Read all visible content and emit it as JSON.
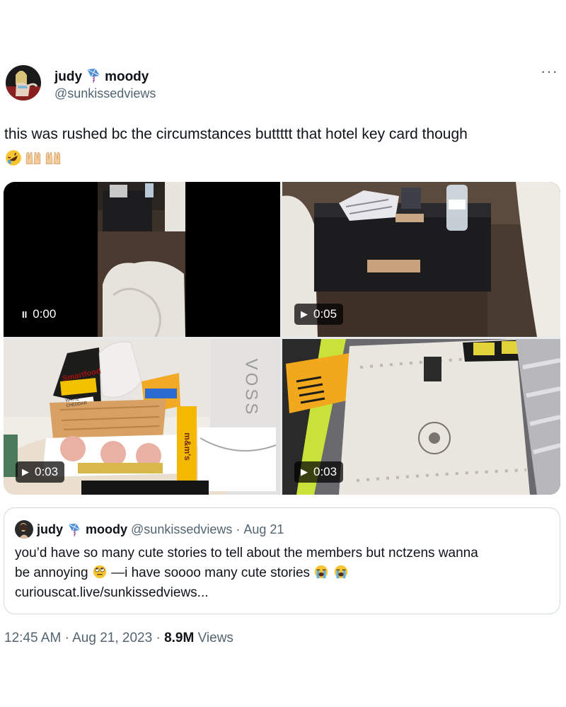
{
  "tweet": {
    "author_name_first": "judy",
    "author_name_second": "moody",
    "author_handle": "@sunkissedviews",
    "more_label": "···",
    "text": "this was rushed bc the circumstances buttttt that hotel key card though",
    "emojis": [
      "rolling-on-floor-laughing",
      "palms-up-together",
      "palms-up-together"
    ]
  },
  "media": [
    {
      "state_icon": "pause-icon",
      "glyph": "II",
      "duration": "0:00"
    },
    {
      "state_icon": "play-icon",
      "glyph": "▶",
      "duration": "0:05"
    },
    {
      "state_icon": "play-icon",
      "glyph": "▶",
      "duration": "0:03"
    },
    {
      "state_icon": "play-icon",
      "glyph": "▶",
      "duration": "0:03"
    }
  ],
  "media_text": {
    "smartfood": "Smartfood",
    "white_cheddar": "WHITE CHEDDAR",
    "voss": "VOSS",
    "mms": "m&m's"
  },
  "quote": {
    "name_first": "judy",
    "name_second": "moody",
    "handle": "@sunkissedviews",
    "separator": "·",
    "date": "Aug 21",
    "line1": "you’d have so many cute stories to tell about the members but nctzens wanna",
    "line2_a": "be annoying",
    "line2_b": "—i have soooo many cute stories",
    "line3": "curiouscat.live/sunkissedviews..."
  },
  "footer": {
    "time": "12:45 AM",
    "sep1": "·",
    "date": "Aug 21, 2023",
    "sep2": "·",
    "views_count": "8.9M",
    "views_label": "Views"
  },
  "colors": {
    "text": "#0f1419",
    "muted": "#536471",
    "border": "#cfd9de",
    "kite": "#4a90d9"
  }
}
